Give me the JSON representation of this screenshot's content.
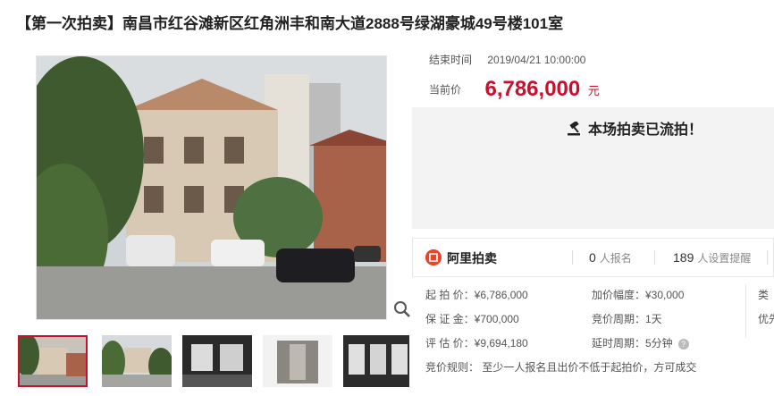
{
  "title": "【第一次拍卖】南昌市红谷滩新区红角洲丰和南大道2888号绿湖豪城49号楼101室",
  "auction": {
    "end_label": "结束时间",
    "end_value": "2019/04/21 10:00:00",
    "price_label": "当前价",
    "price_value": "6,786,000",
    "price_unit": "元",
    "status": "本场拍卖已流拍！"
  },
  "bar": {
    "brand": "阿里拍卖",
    "signup_count": "0",
    "signup_label": "人报名",
    "remind_count": "189",
    "remind_label": "人设置提醒"
  },
  "details": {
    "start_price": "起 拍 价：¥6,786,000",
    "increment": "加价幅度：¥30,000",
    "col3_top": "类",
    "deposit": "保 证 金：¥700,000",
    "cycle": "竞价周期：1天",
    "col3_mid": "优先",
    "appraisal": "评 估 价：¥9,694,180",
    "extension": "延时周期：5分钟",
    "rule": "竞价规则：  至少一人报名且出价不低于起拍价，方可成交"
  },
  "colors": {
    "accent": "#c8102e",
    "brand": "#e8442a"
  },
  "icons": [
    "hammer-icon",
    "zoom-icon",
    "aliauction-logo-icon",
    "help-icon"
  ]
}
